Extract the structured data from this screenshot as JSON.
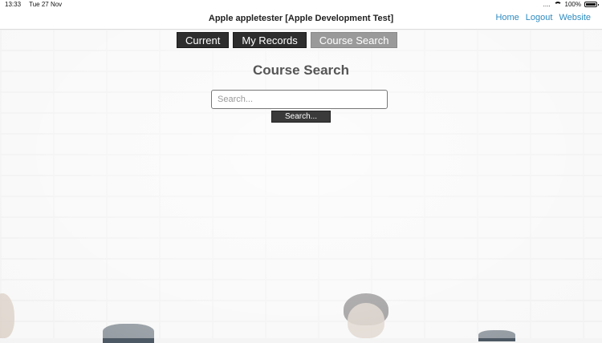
{
  "status_bar": {
    "time": "13:33",
    "date": "Tue 27 Nov",
    "signal": "....",
    "battery_text": "100%",
    "battery_level": 1.0
  },
  "header": {
    "title": "Apple appletester [Apple Development Test]",
    "links": [
      "Home",
      "Logout",
      "Website"
    ]
  },
  "tabs": [
    {
      "label": "Current",
      "active": false
    },
    {
      "label": "My Records",
      "active": false
    },
    {
      "label": "Course Search",
      "active": true
    }
  ],
  "main": {
    "heading": "Course Search",
    "search_placeholder": "Search...",
    "search_button": "Search..."
  },
  "colors": {
    "link": "#2e8bc0",
    "tab_bg": "#2e2e2e",
    "tab_active_bg": "#9a9a9a"
  }
}
